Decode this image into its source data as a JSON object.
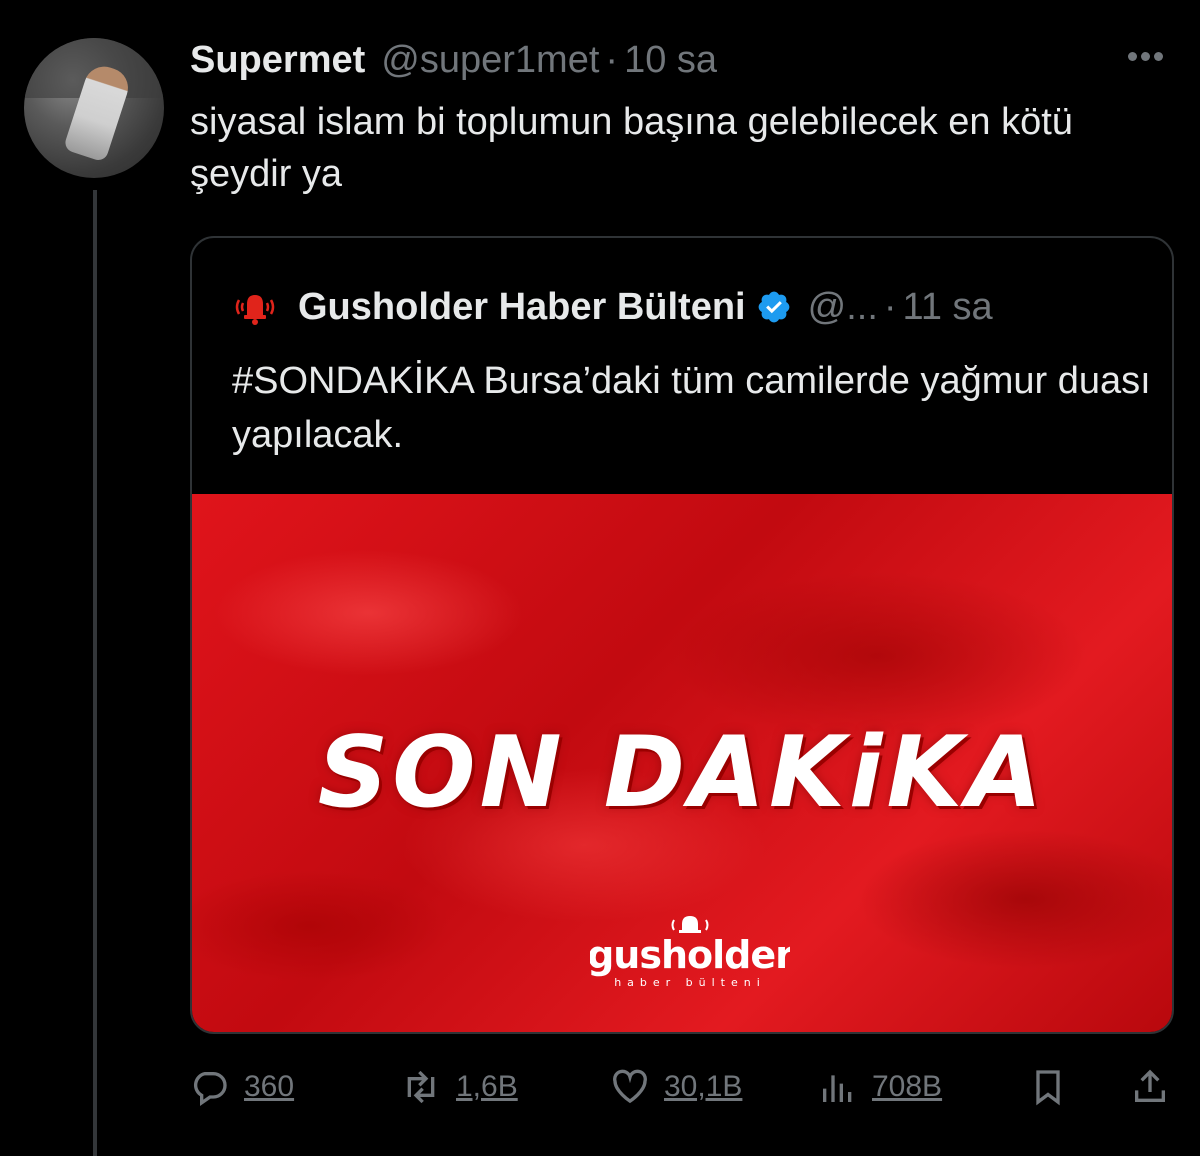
{
  "tweet": {
    "display_name": "Supermet",
    "handle": "@super1met",
    "separator": "·",
    "time": "10 sa",
    "text": "siyasal islam bi toplumun başına gelebilecek en kötü şeydir ya"
  },
  "quote": {
    "display_name": "Gusholder Haber Bülteni",
    "handle": "@...",
    "separator": "·",
    "time": "11 sa",
    "text": "#SONDAKİKA Bursa’daki tüm camilerde yağmur duası yapılacak.",
    "media": {
      "headline": "SON DAKiKA",
      "logo_name": "gusholder",
      "logo_tagline": "haber bülteni"
    }
  },
  "actions": {
    "replies": "360",
    "retweets": "1,6B",
    "likes": "30,1B",
    "views": "708B"
  },
  "colors": {
    "background": "#000000",
    "text": "#e7e9ea",
    "muted": "#71767b",
    "border": "#2f3336",
    "verified": "#1d9bf0",
    "alert_red": "#e0141b"
  },
  "icons": [
    "more-icon",
    "alarm-bell-icon",
    "verified-badge-icon",
    "reply-icon",
    "retweet-icon",
    "like-icon",
    "views-icon",
    "bookmark-icon",
    "share-icon"
  ]
}
